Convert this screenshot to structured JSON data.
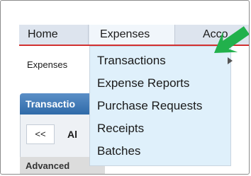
{
  "menubar": {
    "items": [
      {
        "label": "Home"
      },
      {
        "label": "Expenses"
      },
      {
        "label": "Acco"
      }
    ]
  },
  "breadcrumb": "Expenses",
  "panel": {
    "header": "Transactio",
    "prev_label": "<<",
    "tab_label": "Al",
    "advanced_label": "Advanced"
  },
  "dropdown": {
    "items": [
      {
        "label": "Transactions"
      },
      {
        "label": "Expense Reports"
      },
      {
        "label": "Purchase Requests"
      },
      {
        "label": "Receipts"
      },
      {
        "label": "Batches"
      }
    ]
  },
  "colors": {
    "menubar_bg": "#dde4ee",
    "menubar_underline": "#d23030",
    "dropdown_bg": "#dff0fb",
    "panel_header": "#2f6aa8",
    "annotation_arrow": "#22b14c"
  },
  "icons": {
    "submenu": "chevron-right-icon",
    "annotation": "green-arrow-icon"
  }
}
